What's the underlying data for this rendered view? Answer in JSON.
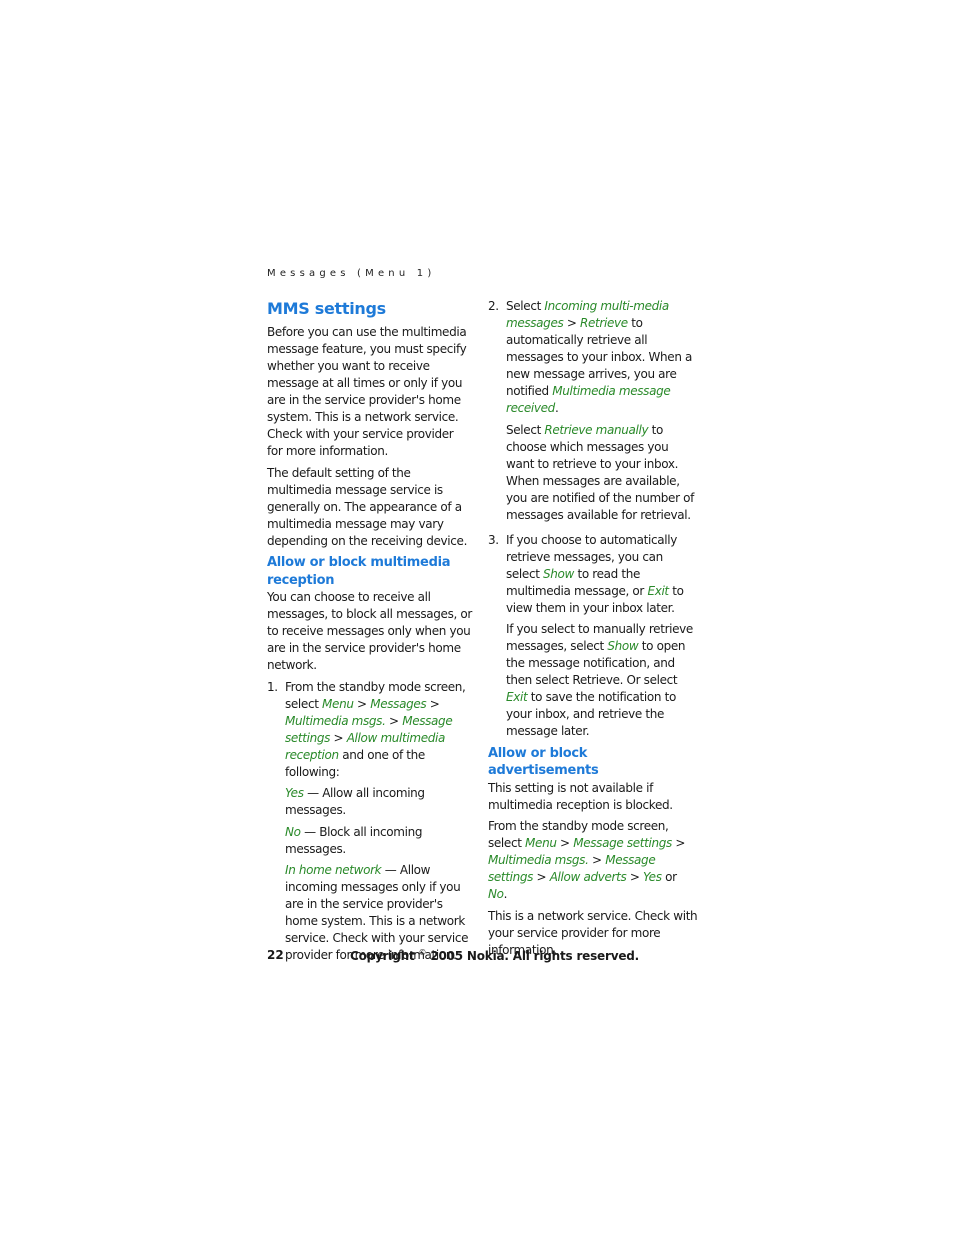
{
  "header": {
    "running_title": "Messages (Menu 1)"
  },
  "left_column": {
    "title": "MMS settings",
    "intro_p1": "Before you can use the multimedia message feature, you must specify whether you want to receive message at all times or only if you are in the service provider's home system. This is a network service. Check with your service provider for more information.",
    "intro_p2": "The default setting of the multimedia message service is generally on. The appearance of a multimedia message may vary depending on the receiving device.",
    "section1_heading": "Allow or block multimedia reception",
    "section1_p": "You can choose to receive all messages, to block all messages, or to receive messages only when you are in the service provider's home network.",
    "step1": {
      "num": "1.",
      "t1": "From the standby mode screen, select ",
      "menu": "Menu",
      "gt": " > ",
      "messages": "Messages",
      "multimedia_msgs": "Multimedia msgs.",
      "message_settings": "Message settings",
      "allow_multimedia_reception": "Allow multimedia reception",
      "t2": " and one of the following:"
    },
    "options": [
      {
        "label": "Yes",
        "desc": " — Allow all incoming messages."
      },
      {
        "label": "No",
        "desc": " — Block all incoming messages."
      },
      {
        "label": "In home network",
        "desc": " — Allow incoming messages only if you are in the service provider's home system. This is a network service. Check with your service provider for more information."
      }
    ]
  },
  "right_column": {
    "step2": {
      "num": "2.",
      "t1": "Select ",
      "incoming": "Incoming multi-media messages",
      "gt": " > ",
      "retrieve": "Retrieve",
      "t2": " to automatically retrieve all messages to your inbox. When a new message arrives, you are notified ",
      "received": "Multimedia message received",
      "t3": ".",
      "p2_t1": "Select ",
      "retrieve_manually": "Retrieve manually",
      "p2_t2": " to choose which messages you want to retrieve to your inbox. When messages are available, you are notified of the number of messages available for retrieval."
    },
    "step3": {
      "num": "3.",
      "t1": "If you choose to automatically retrieve messages, you can select ",
      "show": "Show",
      "t2": " to read the multimedia message, or ",
      "exit": "Exit",
      "t3": " to view them in your inbox later.",
      "p2_t1": "If you select to manually retrieve messages, select ",
      "p2_t2": " to open the message notification, and then select Retrieve. Or select ",
      "p2_t3": " to save the notification to your inbox, and retrieve the message later."
    },
    "section2_heading": "Allow or block advertisements",
    "section2_p1": "This setting is not available if multimedia reception is blocked.",
    "section2_path": {
      "t1": "From the standby mode screen, select ",
      "menu": "Menu",
      "gt": " > ",
      "message_settings": "Message settings",
      "multimedia_msgs": "Multimedia msgs.",
      "message_settings2": "Message settings",
      "allow_adverts": "Allow adverts",
      "yes": "Yes",
      "or": " or ",
      "no": "No",
      "end": "."
    },
    "section2_p3": "This is a network service. Check with your service provider for more information."
  },
  "footer": {
    "page_number": "22",
    "copyright_pre": "Copyright ",
    "copyright_symbol": "©",
    "copyright_post": " 2005 Nokia. All rights reserved."
  },
  "colors": {
    "heading": "#1e7ad8",
    "menu_path": "#2a8a2a"
  }
}
